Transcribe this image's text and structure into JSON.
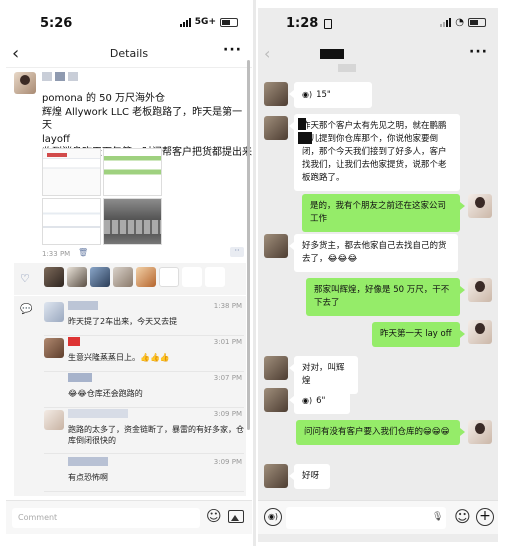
{
  "left": {
    "status": {
      "time": "5:26",
      "network": "5G+"
    },
    "nav": {
      "back": "‹",
      "title": "Details",
      "more": "···"
    },
    "post": {
      "text_line1": "pomona 的 50 万尺海外仓",
      "text_line2": "辉煌 Allywork LLC 老板跑路了，昨天是第一天",
      "text_line3": "layoff",
      "text_line4": "收到消息昨天下午第一时间帮客户把货都提出来",
      "time": "1:33 PM",
      "trash_icon": "trash-icon",
      "more": "··"
    },
    "comments": [
      {
        "time": "1:38 PM",
        "text": "昨天提了2车出来，今天又去提"
      },
      {
        "time": "3:01 PM",
        "text": "生意兴隆蒸蒸日上。👍👍👍"
      },
      {
        "time": "3:07 PM",
        "text": "😂😂仓库还会跑路的"
      },
      {
        "time": "3:09 PM",
        "text": "跑路的太多了，资金链断了，暴雷的有好多家，仓库倒闭很快的"
      },
      {
        "time": "3:09 PM",
        "text": "有点恐怖啊"
      }
    ],
    "composer_placeholder": "Comment"
  },
  "right": {
    "status": {
      "time": "1:28"
    },
    "nav": {
      "back": "‹",
      "more": "···"
    },
    "messages": [
      {
        "side": "in",
        "text": "15\""
      },
      {
        "side": "in",
        "text": "昨天那个客户太有先见之明，就在鹏鹏那儿提到你仓库那个，你说他家要倒闭，那个今天我们接到了好多人，客户找我们，让我们去他家提货，说那个老板跑路了。"
      },
      {
        "side": "out",
        "text": "是的，我有个朋友之前还在这家公司工作"
      },
      {
        "side": "in",
        "text": "好多货主，都去他家自己去找自己的货去了，😂😂😂"
      },
      {
        "side": "out",
        "text": "那家叫辉煌，好像是 50 万尺，干不下去了"
      },
      {
        "side": "out",
        "text": "昨天第一天 lay off"
      },
      {
        "side": "in",
        "text": "对对，叫辉煌"
      },
      {
        "side": "in",
        "text": "6\""
      },
      {
        "side": "out",
        "text": "问问有没有客户要入我们仓库的😁😁😁"
      },
      {
        "side": "in",
        "text": "好呀"
      }
    ]
  }
}
